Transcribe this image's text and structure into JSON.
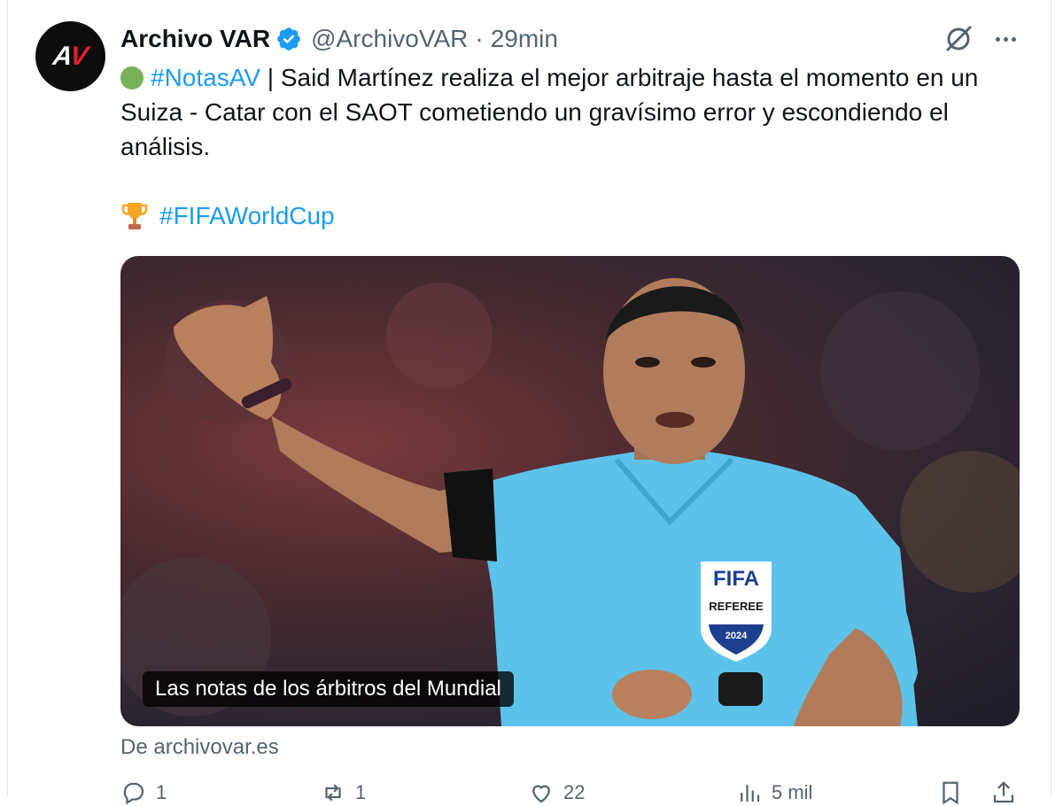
{
  "tweet": {
    "display_name": "Archivo VAR",
    "handle": "@ArchivoVAR",
    "separator": "·",
    "time": "29min",
    "body": {
      "hashtag1": "#NotasAV",
      "text1": " | Said Martínez realiza el mejor arbitraje hasta el momento en un Suiza - Catar con el SAOT cometiendo un gravísimo error y escondiendo el análisis.",
      "hashtag2": "#FIFAWorldCup"
    },
    "card": {
      "caption": "Las notas de los árbitros del Mundial",
      "source": "De archivovar.es",
      "badge_top": "FIFA",
      "badge_mid": "REFEREE",
      "badge_year": "2024"
    },
    "actions": {
      "replies": "1",
      "reposts": "1",
      "likes": "22",
      "views": "5 mil"
    }
  },
  "colors": {
    "link": "#1d9bf0",
    "secondary": "#536471",
    "verified": "#1d9bf0",
    "jersey": "#5cc2ea"
  },
  "icons": [
    "verified-badge-icon",
    "grok-icon",
    "more-icon",
    "green-circle-emoji",
    "trophy-emoji",
    "reply-icon",
    "repost-icon",
    "like-icon",
    "views-icon",
    "bookmark-icon",
    "share-icon"
  ]
}
